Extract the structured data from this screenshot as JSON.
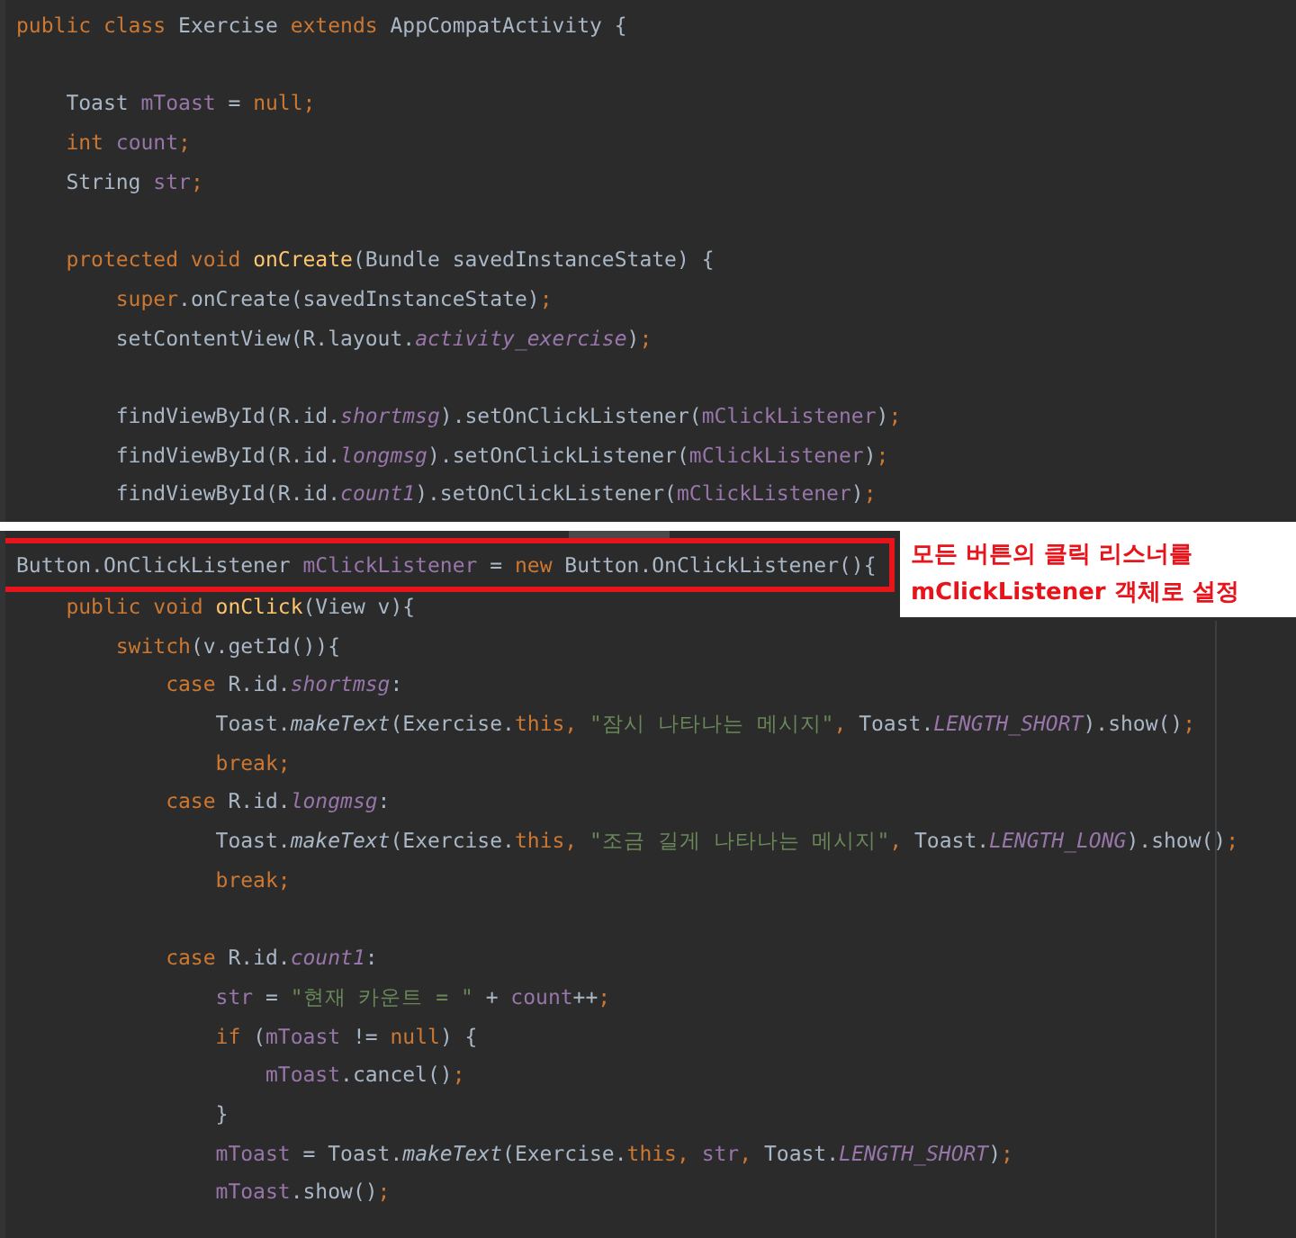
{
  "panes": [
    {
      "lines": [
        {
          "segments": [
            {
              "text": "public class ",
              "kind": "keyword"
            },
            {
              "text": "Exercise ",
              "kind": "plain"
            },
            {
              "text": "extends ",
              "kind": "keyword"
            },
            {
              "text": "AppCompatActivity {",
              "kind": "plain"
            }
          ]
        },
        {
          "gap_before": true,
          "segments": [
            {
              "text": "    Toast ",
              "kind": "plain"
            },
            {
              "text": "mToast",
              "kind": "field"
            },
            {
              "text": " = ",
              "kind": "plain"
            },
            {
              "text": "null;",
              "kind": "keyword"
            }
          ]
        },
        {
          "segments": [
            {
              "text": "    int ",
              "kind": "keyword"
            },
            {
              "text": "count",
              "kind": "field"
            },
            {
              "text": ";",
              "kind": "keyword"
            }
          ]
        },
        {
          "segments": [
            {
              "text": "    String ",
              "kind": "plain"
            },
            {
              "text": "str",
              "kind": "field"
            },
            {
              "text": ";",
              "kind": "keyword"
            }
          ]
        },
        {
          "gap_before": true,
          "segments": [
            {
              "text": "    protected void ",
              "kind": "keyword"
            },
            {
              "text": "onCreate",
              "kind": "method"
            },
            {
              "text": "(Bundle savedInstanceState) {",
              "kind": "plain"
            }
          ]
        },
        {
          "segments": [
            {
              "text": "        super",
              "kind": "keyword"
            },
            {
              "text": ".onCreate(savedInstanceState)",
              "kind": "plain"
            },
            {
              "text": ";",
              "kind": "keyword"
            }
          ]
        },
        {
          "segments": [
            {
              "text": "        setContentView(R.layout.",
              "kind": "plain"
            },
            {
              "text": "activity_exercise",
              "kind": "constant"
            },
            {
              "text": ")",
              "kind": "plain"
            },
            {
              "text": ";",
              "kind": "keyword"
            }
          ]
        },
        {
          "gap_before": true,
          "segments": [
            {
              "text": "        findViewById(R.id.",
              "kind": "plain"
            },
            {
              "text": "shortmsg",
              "kind": "constant"
            },
            {
              "text": ").setOnClickListener(",
              "kind": "plain"
            },
            {
              "text": "mClickListener",
              "kind": "field"
            },
            {
              "text": ")",
              "kind": "plain"
            },
            {
              "text": ";",
              "kind": "keyword"
            }
          ]
        },
        {
          "segments": [
            {
              "text": "        findViewById(R.id.",
              "kind": "plain"
            },
            {
              "text": "longmsg",
              "kind": "constant"
            },
            {
              "text": ").setOnClickListener(",
              "kind": "plain"
            },
            {
              "text": "mClickListener",
              "kind": "field"
            },
            {
              "text": ")",
              "kind": "plain"
            },
            {
              "text": ";",
              "kind": "keyword"
            }
          ]
        },
        {
          "segments": [
            {
              "text": "        findViewById(R.id.",
              "kind": "plain"
            },
            {
              "text": "count1",
              "kind": "constant"
            },
            {
              "text": ").setOnClickListener(",
              "kind": "plain"
            },
            {
              "text": "mClickListener",
              "kind": "field"
            },
            {
              "text": ")",
              "kind": "plain"
            },
            {
              "text": ";",
              "kind": "keyword"
            }
          ]
        }
      ]
    },
    {
      "lines": [
        {
          "segments": [
            {
              "text": "Button.OnClickListener ",
              "kind": "plain"
            },
            {
              "text": "mClickListener",
              "kind": "field"
            },
            {
              "text": " = ",
              "kind": "plain"
            },
            {
              "text": "new ",
              "kind": "keyword"
            },
            {
              "text": "Button.OnClickListener(){",
              "kind": "plain"
            }
          ]
        },
        {
          "segments": [
            {
              "text": "    public void ",
              "kind": "keyword"
            },
            {
              "text": "onClick",
              "kind": "method"
            },
            {
              "text": "(View v){",
              "kind": "plain"
            }
          ]
        },
        {
          "segments": [
            {
              "text": "        switch",
              "kind": "keyword"
            },
            {
              "text": "(v.getId()){",
              "kind": "plain"
            }
          ]
        },
        {
          "segments": [
            {
              "text": "            case ",
              "kind": "keyword"
            },
            {
              "text": "R.id.",
              "kind": "plain"
            },
            {
              "text": "shortmsg",
              "kind": "constant"
            },
            {
              "text": ":",
              "kind": "plain"
            }
          ]
        },
        {
          "segments": [
            {
              "text": "                Toast.",
              "kind": "plain"
            },
            {
              "text": "makeText",
              "kind": "static"
            },
            {
              "text": "(Exercise.",
              "kind": "plain"
            },
            {
              "text": "this, ",
              "kind": "keyword"
            },
            {
              "text": "\"잠시 나타나는 메시지\"",
              "kind": "string"
            },
            {
              "text": ", ",
              "kind": "keyword"
            },
            {
              "text": "Toast.",
              "kind": "plain"
            },
            {
              "text": "LENGTH_SHORT",
              "kind": "constant"
            },
            {
              "text": ").show()",
              "kind": "plain"
            },
            {
              "text": ";",
              "kind": "keyword"
            }
          ]
        },
        {
          "segments": [
            {
              "text": "                break;",
              "kind": "keyword"
            }
          ]
        },
        {
          "segments": [
            {
              "text": "            case ",
              "kind": "keyword"
            },
            {
              "text": "R.id.",
              "kind": "plain"
            },
            {
              "text": "longmsg",
              "kind": "constant"
            },
            {
              "text": ":",
              "kind": "plain"
            }
          ]
        },
        {
          "segments": [
            {
              "text": "                Toast.",
              "kind": "plain"
            },
            {
              "text": "makeText",
              "kind": "static"
            },
            {
              "text": "(Exercise.",
              "kind": "plain"
            },
            {
              "text": "this, ",
              "kind": "keyword"
            },
            {
              "text": "\"조금 길게 나타나는 메시지\"",
              "kind": "string"
            },
            {
              "text": ", ",
              "kind": "keyword"
            },
            {
              "text": "Toast.",
              "kind": "plain"
            },
            {
              "text": "LENGTH_LONG",
              "kind": "constant"
            },
            {
              "text": ").show()",
              "kind": "plain"
            },
            {
              "text": ";",
              "kind": "keyword"
            }
          ]
        },
        {
          "segments": [
            {
              "text": "                break;",
              "kind": "keyword"
            }
          ]
        },
        {
          "gap_before": true,
          "segments": [
            {
              "text": "            case ",
              "kind": "keyword"
            },
            {
              "text": "R.id.",
              "kind": "plain"
            },
            {
              "text": "count1",
              "kind": "constant"
            },
            {
              "text": ":",
              "kind": "plain"
            }
          ]
        },
        {
          "segments": [
            {
              "text": "                str",
              "kind": "field"
            },
            {
              "text": " = ",
              "kind": "plain"
            },
            {
              "text": "\"현재 카운트 = \"",
              "kind": "string"
            },
            {
              "text": " + ",
              "kind": "plain"
            },
            {
              "text": "count",
              "kind": "field"
            },
            {
              "text": "++",
              "kind": "plain"
            },
            {
              "text": ";",
              "kind": "keyword"
            }
          ]
        },
        {
          "segments": [
            {
              "text": "                if ",
              "kind": "keyword"
            },
            {
              "text": "(",
              "kind": "plain"
            },
            {
              "text": "mToast",
              "kind": "field"
            },
            {
              "text": " != ",
              "kind": "plain"
            },
            {
              "text": "null",
              "kind": "keyword"
            },
            {
              "text": ") {",
              "kind": "plain"
            }
          ]
        },
        {
          "segments": [
            {
              "text": "                    mToast",
              "kind": "field"
            },
            {
              "text": ".cancel()",
              "kind": "plain"
            },
            {
              "text": ";",
              "kind": "keyword"
            }
          ]
        },
        {
          "segments": [
            {
              "text": "                }",
              "kind": "plain"
            }
          ]
        },
        {
          "segments": [
            {
              "text": "                mToast",
              "kind": "field"
            },
            {
              "text": " = Toast.",
              "kind": "plain"
            },
            {
              "text": "makeText",
              "kind": "static"
            },
            {
              "text": "(Exercise.",
              "kind": "plain"
            },
            {
              "text": "this, ",
              "kind": "keyword"
            },
            {
              "text": "str",
              "kind": "field"
            },
            {
              "text": ", ",
              "kind": "keyword"
            },
            {
              "text": "Toast.",
              "kind": "plain"
            },
            {
              "text": "LENGTH_SHORT",
              "kind": "constant"
            },
            {
              "text": ")",
              "kind": "plain"
            },
            {
              "text": ";",
              "kind": "keyword"
            }
          ]
        },
        {
          "segments": [
            {
              "text": "                mToast",
              "kind": "field"
            },
            {
              "text": ".show()",
              "kind": "plain"
            },
            {
              "text": ";",
              "kind": "keyword"
            }
          ]
        }
      ]
    }
  ],
  "annotation": {
    "lines": [
      "모든 버튼의 클릭 리스너를",
      "mClickListener 객체로 설정"
    ]
  }
}
